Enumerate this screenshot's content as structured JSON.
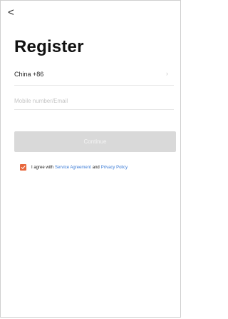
{
  "header": {
    "back_glyph": "<"
  },
  "title": "Register",
  "country": {
    "label": "China +86",
    "chevron": "›"
  },
  "account_field": {
    "placeholder": "Mobile number/Email",
    "value": ""
  },
  "continue_label": "Continue",
  "agreement": {
    "checked": true,
    "prefix": "I agree with",
    "service_link": "Service Agreement",
    "and": "and",
    "privacy_link": "Privacy Policy"
  },
  "colors": {
    "accent": "#e8673c",
    "link": "#3b7bd6",
    "button_disabled": "#d9d9d9"
  },
  "icons": {
    "back": "back-arrow-icon",
    "chevron": "chevron-right-icon",
    "check": "checkmark-icon"
  }
}
